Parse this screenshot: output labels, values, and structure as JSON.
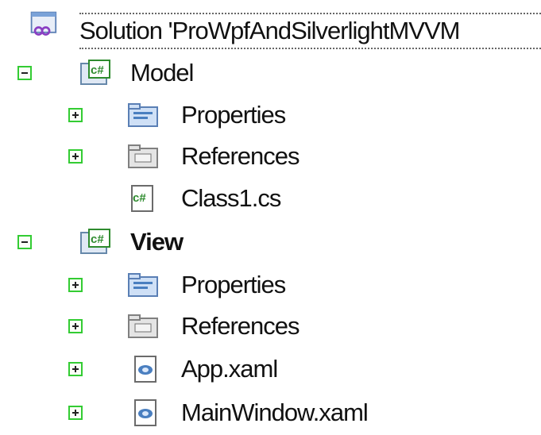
{
  "tree": {
    "solution": {
      "icon": "solution-icon",
      "label": "Solution 'ProWpfAndSilverlightMVVM"
    },
    "projects": [
      {
        "name": "Model",
        "icon": "csharp-project-icon",
        "toggle": "minus",
        "bold": false,
        "items": [
          {
            "icon": "properties-folder-icon",
            "label": "Properties",
            "toggle": "plus"
          },
          {
            "icon": "references-folder-icon",
            "label": "References",
            "toggle": "plus"
          },
          {
            "icon": "csharp-file-icon",
            "label": "Class1.cs",
            "toggle": "none"
          }
        ]
      },
      {
        "name": "View",
        "icon": "csharp-project-icon",
        "toggle": "minus",
        "bold": true,
        "items": [
          {
            "icon": "properties-folder-icon",
            "label": "Properties",
            "toggle": "plus"
          },
          {
            "icon": "references-folder-icon",
            "label": "References",
            "toggle": "plus"
          },
          {
            "icon": "xaml-file-icon",
            "label": "App.xaml",
            "toggle": "plus"
          },
          {
            "icon": "xaml-file-icon",
            "label": "MainWindow.xaml",
            "toggle": "plus"
          }
        ]
      }
    ]
  },
  "colors": {
    "toggle_border": "#33cc33",
    "csharp_green": "#2e8b2e",
    "folder_blue": "#4a7fc0"
  }
}
